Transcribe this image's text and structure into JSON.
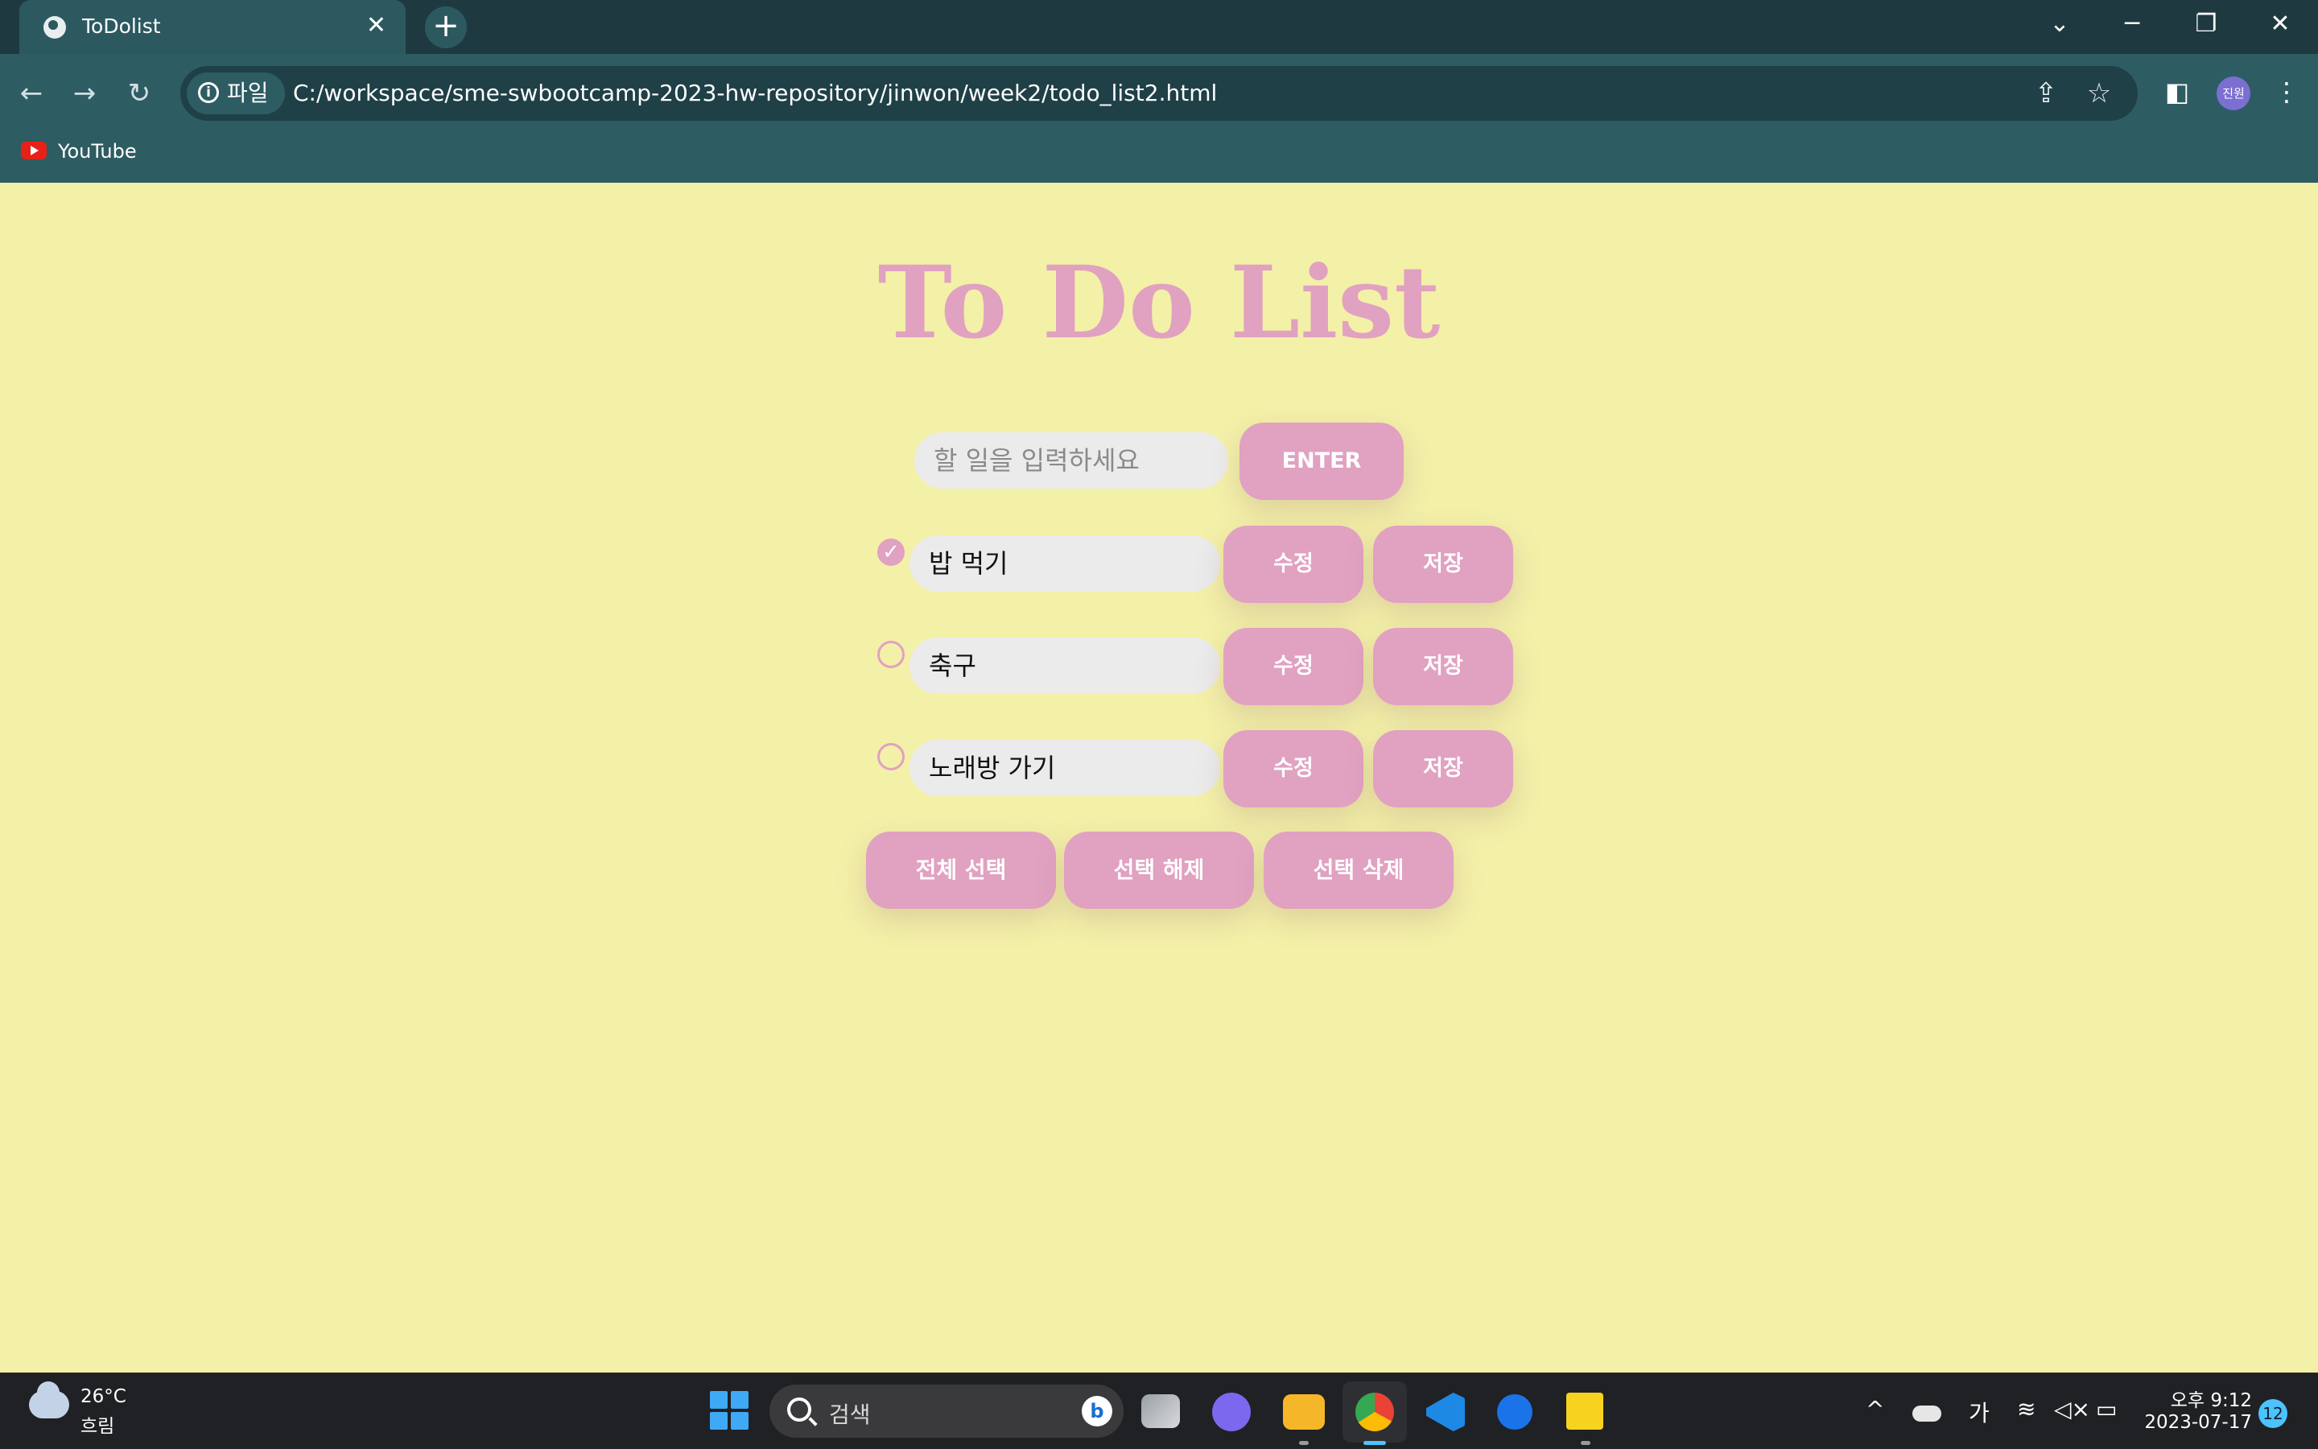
{
  "browser": {
    "tab_title": "ToDolist",
    "tab_close": "✕",
    "new_tab": "+",
    "window_controls": {
      "tab_search": "⌄",
      "minimize": "─",
      "restore": "❐",
      "close": "✕"
    },
    "nav": {
      "back": "←",
      "forward": "→",
      "reload": "↻"
    },
    "info_chip": "파일",
    "url": "C:/workspace/sme-swbootcamp-2023-hw-repository/jinwon/week2/todo_list2.html",
    "omnibox_icons": {
      "share": "⇪",
      "bookmark": "☆"
    },
    "side_panel": "◧",
    "profile_initials": "진원",
    "menu": "⋮",
    "bookmarks": [
      {
        "label": "YouTube"
      }
    ]
  },
  "page": {
    "title": "To Do List",
    "input": {
      "placeholder": "할 일을 입력하세요",
      "value": ""
    },
    "enter_label": "ENTER",
    "items": [
      {
        "text": "밥 먹기",
        "checked": true,
        "check_mark": "✓",
        "edit_label": "수정",
        "save_label": "저장"
      },
      {
        "text": "축구",
        "checked": false,
        "check_mark": "",
        "edit_label": "수정",
        "save_label": "저장"
      },
      {
        "text": "노래방 가기",
        "checked": false,
        "check_mark": "",
        "edit_label": "수정",
        "save_label": "저장"
      }
    ],
    "select_all_label": "전체 선택",
    "deselect_label": "선택 해제",
    "delete_selected_label": "선택 삭제",
    "colors": {
      "background": "#f3f0a8",
      "accent": "#e1a1c1",
      "field": "#ebebeb"
    }
  },
  "taskbar": {
    "weather_temp": "26°C",
    "weather_desc": "흐림",
    "search_placeholder": "검색",
    "bing": "b",
    "tray": {
      "chevron": "^",
      "ime": "가",
      "wifi": "≋",
      "volume": "◁×",
      "battery": "▭"
    },
    "clock_time": "오후 9:12",
    "clock_date": "2023-07-17",
    "notifications": "12",
    "apps": [
      "task-view",
      "chat",
      "file-explorer",
      "chrome",
      "vscode",
      "maps-pin",
      "sticky-notes"
    ]
  }
}
